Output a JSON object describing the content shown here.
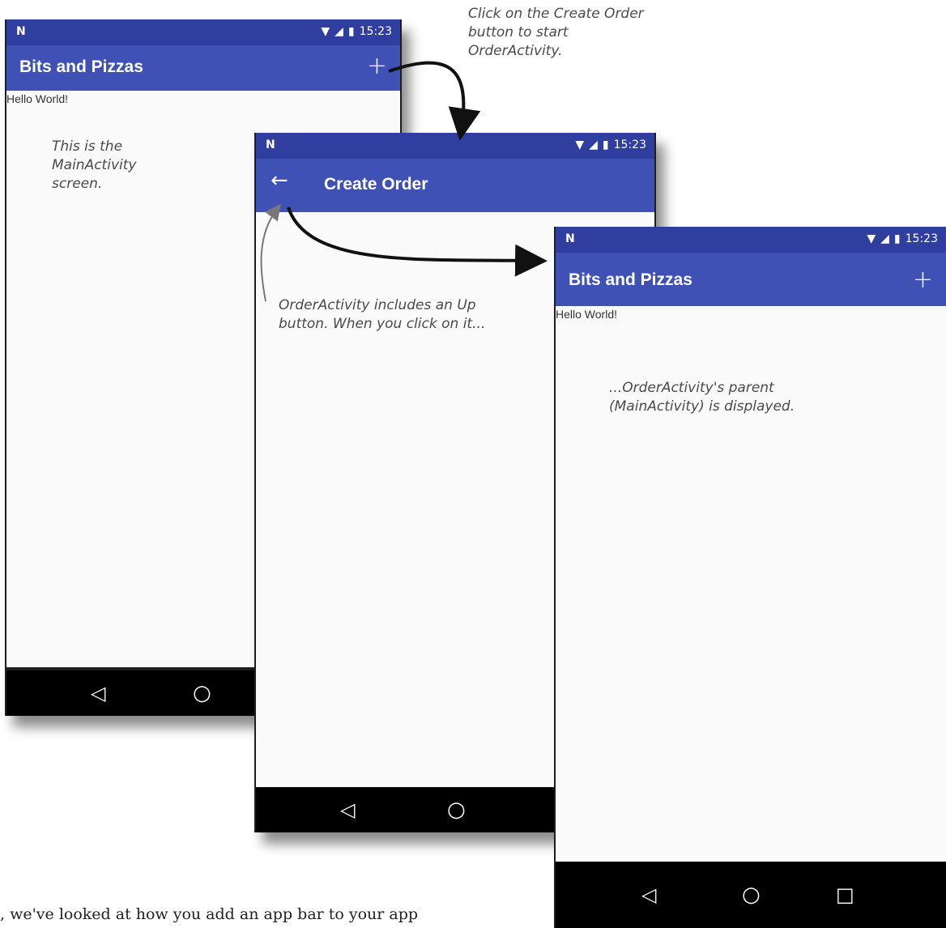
{
  "status": {
    "time": "15:23",
    "logo": "N"
  },
  "screens": {
    "main": {
      "title": "Bits and Pizzas",
      "action_icon": "+",
      "body_text": "Hello World!"
    },
    "order": {
      "title": "Create Order",
      "up_icon": "←"
    },
    "main_again": {
      "title": "Bits and Pizzas",
      "action_icon": "+",
      "body_text": "Hello World!"
    }
  },
  "nav": {
    "back": "◁",
    "home": "○",
    "recents": "□"
  },
  "annotations": {
    "click_create": "Click on the Create Order button to start OrderActivity.",
    "main_screen": "This is the MainActivity screen.",
    "up_button": "OrderActivity includes an Up button. When you click on it...",
    "parent_displayed": "...OrderActivity's parent (MainActivity) is displayed."
  },
  "footer_text": ", we've looked at how you add an app bar to your app",
  "colors": {
    "status_bar": "#303f9f",
    "app_bar": "#3f51b5",
    "content": "#fafafa",
    "nav_bar": "#000000"
  }
}
